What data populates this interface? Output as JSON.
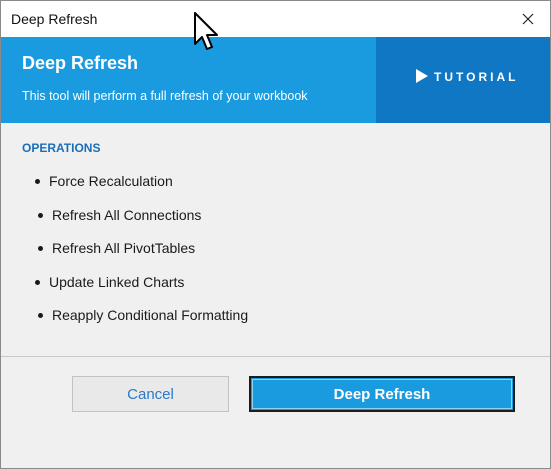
{
  "window": {
    "title": "Deep Refresh"
  },
  "banner": {
    "heading": "Deep Refresh",
    "subtitle": "This tool will perform a full refresh of your workbook",
    "tutorial_label": "TUTORIAL",
    "tutorial_icon": "play-icon",
    "color": "#1a9be0",
    "tutorial_color": "#0f77c3"
  },
  "operations": {
    "title": "OPERATIONS",
    "items": [
      {
        "label": "Force Recalculation"
      },
      {
        "label": "Refresh All Connections"
      },
      {
        "label": "Refresh All PivotTables"
      },
      {
        "label": "Update Linked Charts"
      },
      {
        "label": "Reapply Conditional Formatting"
      }
    ]
  },
  "buttons": {
    "cancel_label": "Cancel",
    "primary_label": "Deep Refresh"
  },
  "icons": {
    "close": "close-icon",
    "cursor": "mouse-pointer-icon"
  }
}
